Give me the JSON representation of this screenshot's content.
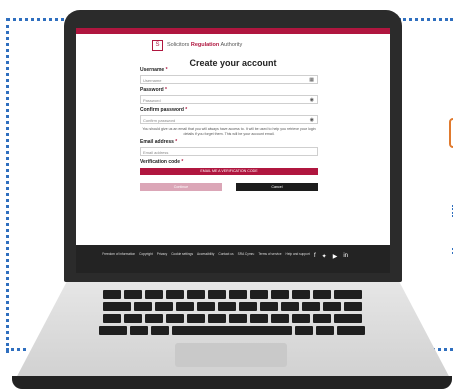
{
  "brand": {
    "logo_text": "S",
    "name_prefix": "Solicitors",
    "name_bold": "Regulation",
    "name_suffix": "Authority"
  },
  "form": {
    "title": "Create your account",
    "username_label": "Username",
    "username_placeholder": "Username",
    "password_label": "Password",
    "password_placeholder": "Password",
    "confirm_label": "Confirm password",
    "confirm_placeholder": "Confirm password",
    "hint": "You should give us an email that you will always have access to. It will be used to help you retrieve your login details if you forget them. This will be your account email.",
    "email_label": "Email address",
    "email_placeholder": "Email address",
    "verification_label": "Verification code",
    "verify_button": "EMAIL ME A VERIFICATION CODE",
    "create_button": "Continue",
    "cancel_button": "Cancel",
    "required_marker": "*"
  },
  "footer": {
    "links": [
      "Freedom of information",
      "Copyright",
      "Privacy",
      "Cookie settings",
      "Accessibility",
      "Contact us",
      "SRA Cymru",
      "Terms of service",
      "Help and support"
    ],
    "social_icons": [
      "facebook-icon",
      "twitter-icon",
      "youtube-icon",
      "linkedin-icon"
    ]
  },
  "colors": {
    "brand": "#b0163f",
    "footer": "#232323",
    "laptop": "#2b2b2b"
  }
}
